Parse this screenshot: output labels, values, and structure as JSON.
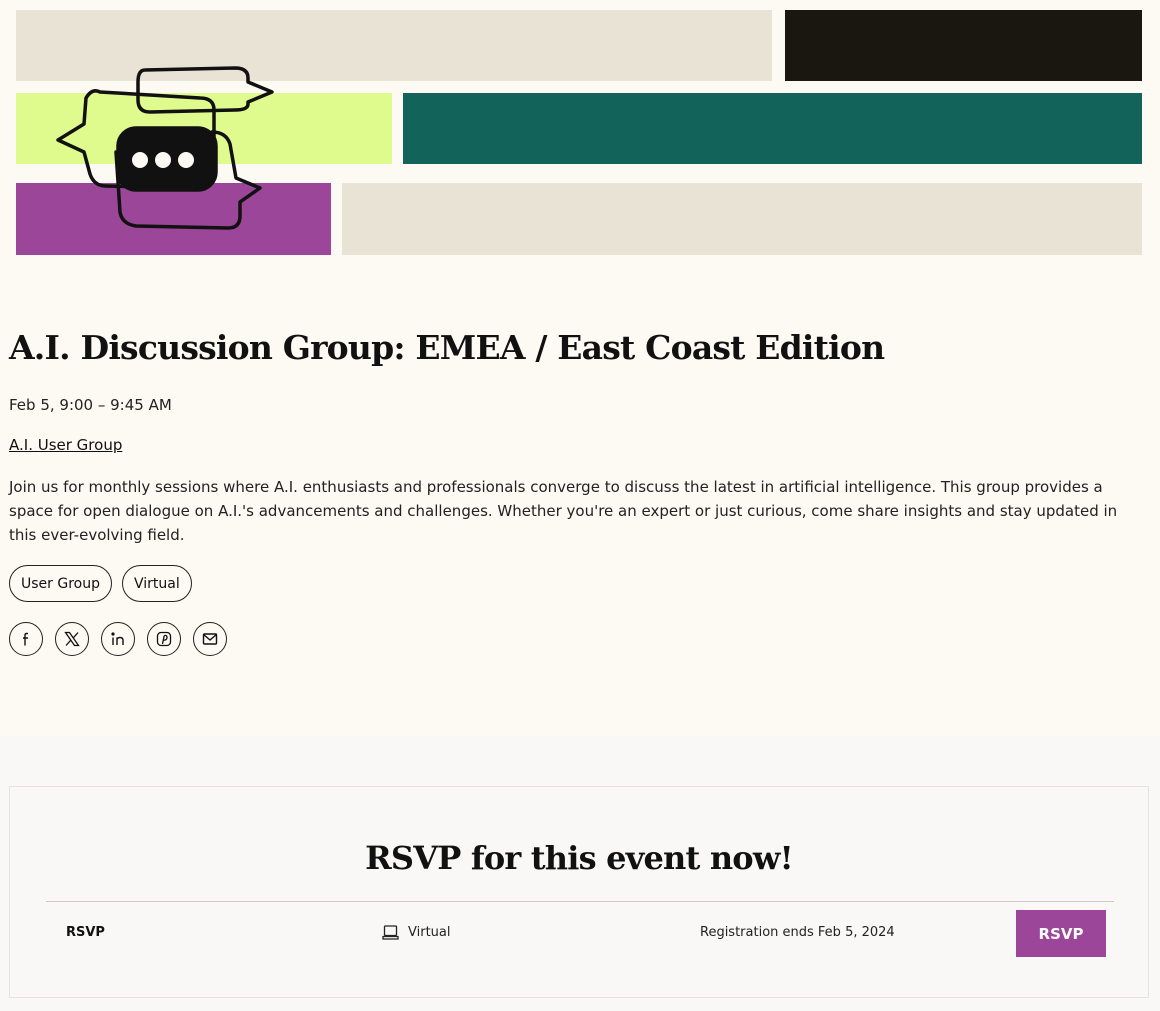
{
  "event": {
    "title": "A.I. Discussion Group: EMEA / East Coast Edition",
    "datetime": "Feb 5, 9:00 – 9:45 AM",
    "group_link": "A.I. User Group",
    "description": "Join us for monthly sessions where A.I. enthusiasts and professionals converge to discuss the latest in artificial intelligence. This group provides a space for open dialogue on A.I.'s advancements and challenges. Whether you're an expert or just curious, come share insights and stay updated in this ever-evolving field.",
    "tags": [
      "User Group",
      "Virtual"
    ]
  },
  "hero": {
    "art_icon": "chat-bubbles-icon",
    "colors": {
      "beige": "#e8e3d4",
      "black": "#1a1710",
      "lime": "#dffa8d",
      "teal": "#12645a",
      "purple": "#9b4699"
    }
  },
  "share": {
    "icons": [
      "facebook-icon",
      "x-icon",
      "linkedin-icon",
      "pinterest-icon",
      "email-icon"
    ]
  },
  "rsvp": {
    "heading": "RSVP for this event now!",
    "label": "RSVP",
    "venue": "Virtual",
    "venue_icon": "laptop-icon",
    "registration": "Registration ends Feb 5, 2024",
    "button": "RSVP",
    "accent": "#9b4699"
  }
}
